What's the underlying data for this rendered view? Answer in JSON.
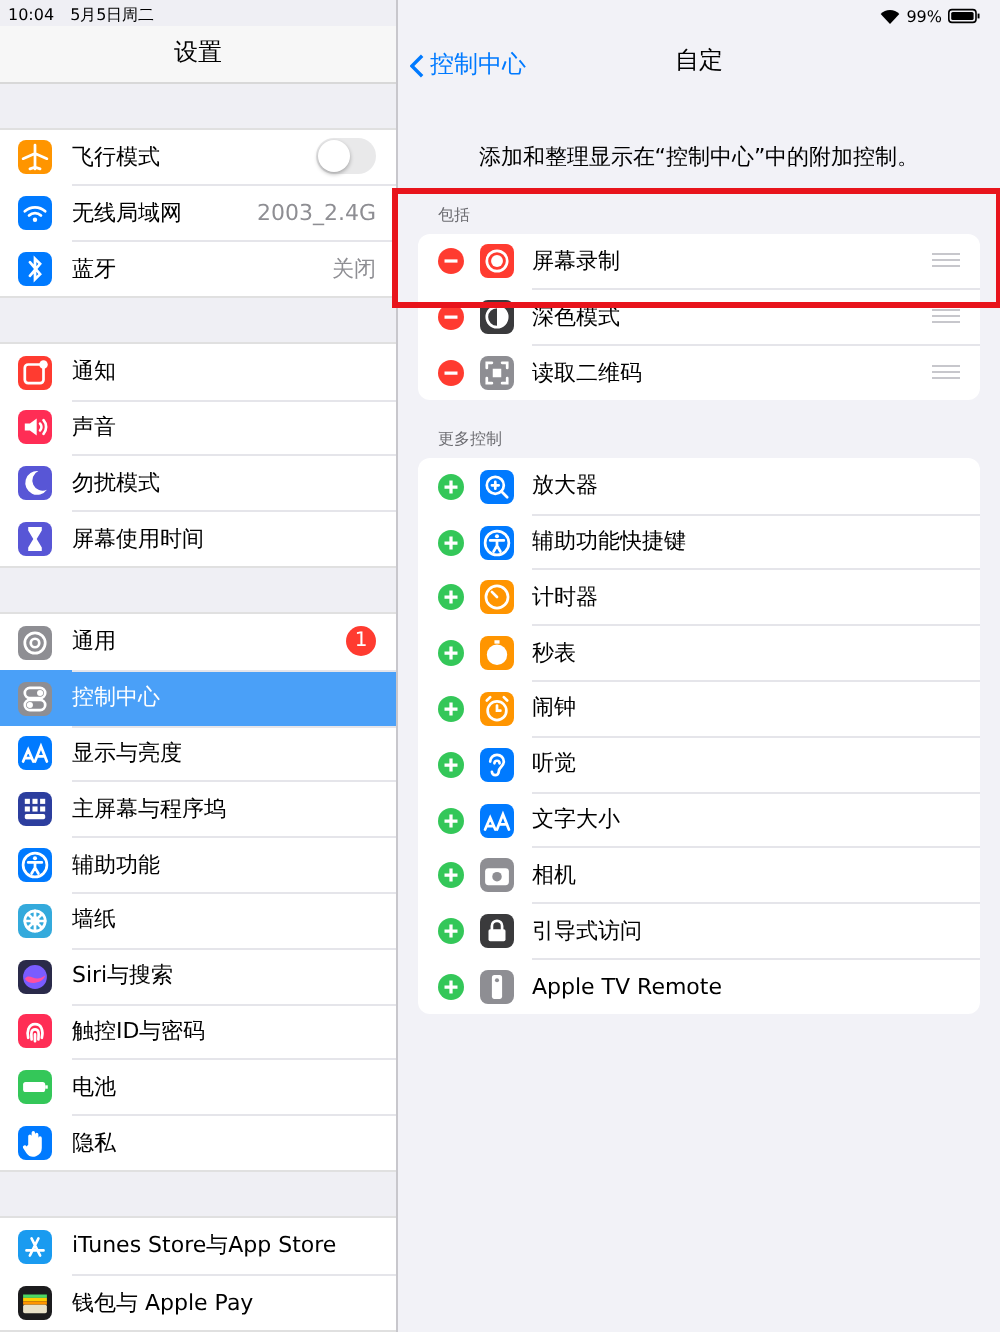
{
  "status_bar": {
    "time": "10:04",
    "date": "5月5日周二",
    "battery": "99%"
  },
  "sidebar": {
    "title": "设置",
    "groups": [
      [
        {
          "label": "飞行模式",
          "kind": "toggle",
          "on": false,
          "color": "#ff9500",
          "selected": false
        },
        {
          "label": "无线局域网",
          "kind": "value",
          "value": "2003_2.4G",
          "color": "#007aff",
          "selected": false
        },
        {
          "label": "蓝牙",
          "kind": "value",
          "value": "关闭",
          "color": "#007aff",
          "selected": false
        }
      ],
      [
        {
          "label": "通知",
          "kind": "plain",
          "color": "#ff3b30",
          "selected": false
        },
        {
          "label": "声音",
          "kind": "plain",
          "color": "#ff2d55",
          "selected": false
        },
        {
          "label": "勿扰模式",
          "kind": "plain",
          "color": "#5856d6",
          "selected": false
        },
        {
          "label": "屏幕使用时间",
          "kind": "plain",
          "color": "#5856d6",
          "selected": false
        }
      ],
      [
        {
          "label": "通用",
          "kind": "badge",
          "badge": "1",
          "color": "#8e8e93",
          "selected": false
        },
        {
          "label": "控制中心",
          "kind": "plain",
          "color": "#8e8e93",
          "selected": true
        },
        {
          "label": "显示与亮度",
          "kind": "plain",
          "color": "#007aff",
          "selected": false
        },
        {
          "label": "主屏幕与程序坞",
          "kind": "plain",
          "color": "#2c3e9e",
          "selected": false
        },
        {
          "label": "辅助功能",
          "kind": "plain",
          "color": "#007aff",
          "selected": false
        },
        {
          "label": "墙纸",
          "kind": "plain",
          "color": "#34aadc",
          "selected": false
        },
        {
          "label": "Siri与搜索",
          "kind": "plain",
          "color": "#2a2a4a",
          "selected": false
        },
        {
          "label": "触控ID与密码",
          "kind": "plain",
          "color": "#ff2d55",
          "selected": false
        },
        {
          "label": "电池",
          "kind": "plain",
          "color": "#34c759",
          "selected": false
        },
        {
          "label": "隐私",
          "kind": "plain",
          "color": "#007aff",
          "selected": false
        }
      ],
      [
        {
          "label": "iTunes Store与App Store",
          "kind": "plain",
          "color": "#1a9bf0",
          "selected": false
        },
        {
          "label": "钱包与 Apple Pay",
          "kind": "plain",
          "color": "#1c1c1e",
          "selected": false
        }
      ]
    ]
  },
  "detail": {
    "back": "控制中心",
    "title": "自定",
    "description": "添加和整理显示在“控制中心”中的附加控制。",
    "sections": [
      {
        "header": "包括",
        "kind": "included",
        "highlight": true,
        "items": [
          {
            "label": "屏幕录制",
            "color": "#ff3b30"
          },
          {
            "label": "深色模式",
            "color": "#3a3a3c"
          },
          {
            "label": "读取二维码",
            "color": "#8e8e93"
          }
        ]
      },
      {
        "header": "更多控制",
        "kind": "more",
        "highlight": false,
        "items": [
          {
            "label": "放大器",
            "color": "#007aff"
          },
          {
            "label": "辅助功能快捷键",
            "color": "#007aff"
          },
          {
            "label": "计时器",
            "color": "#ff9500"
          },
          {
            "label": "秒表",
            "color": "#ff9500"
          },
          {
            "label": "闹钟",
            "color": "#ff9500"
          },
          {
            "label": "听觉",
            "color": "#007aff"
          },
          {
            "label": "文字大小",
            "color": "#007aff"
          },
          {
            "label": "相机",
            "color": "#8e8e93"
          },
          {
            "label": "引导式访问",
            "color": "#3a3a3c"
          },
          {
            "label": "Apple TV Remote",
            "color": "#8e8e93"
          }
        ]
      }
    ]
  }
}
